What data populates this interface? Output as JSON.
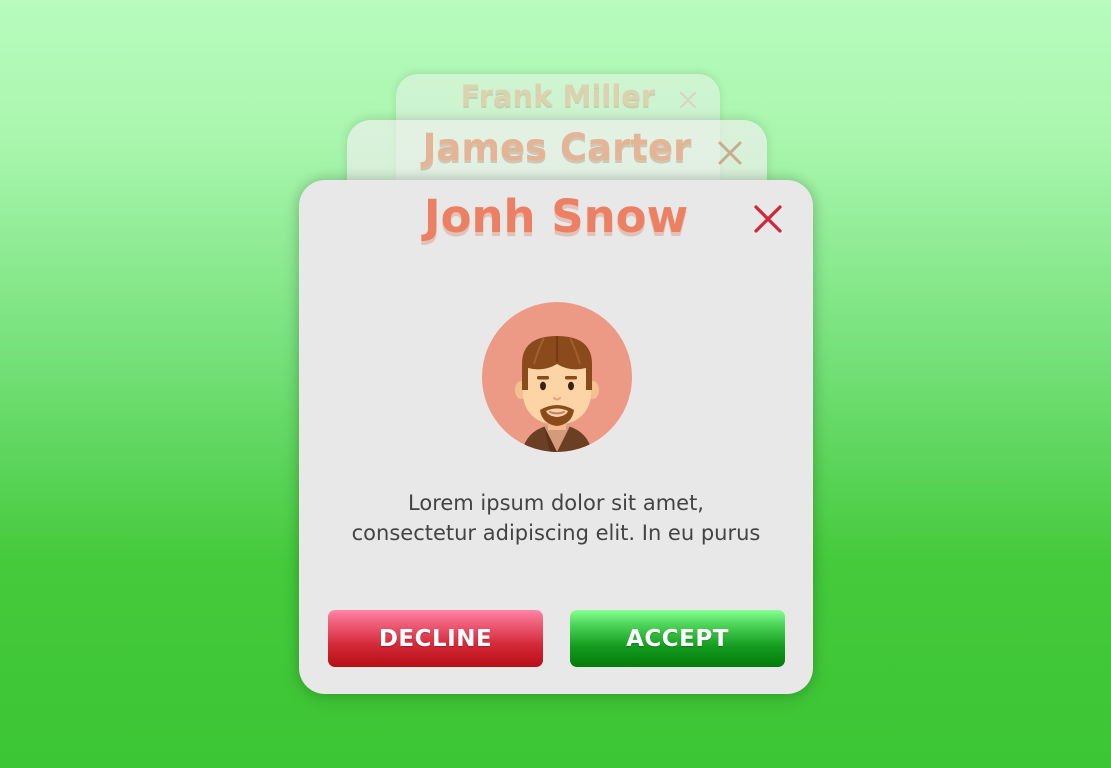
{
  "cards": {
    "back": {
      "name": "Frank Miller"
    },
    "middle": {
      "name": "James Carter"
    },
    "front": {
      "name": "Jonh Snow",
      "message_lines": [
        "Lorem ipsum dolor sit amet,",
        "consectetur adipiscing elit. In eu purus"
      ],
      "decline_label": "DECLINE",
      "accept_label": "ACCEPT"
    }
  },
  "icons": {
    "close": "close-icon",
    "avatar": "man-with-beard-avatar"
  },
  "colors": {
    "name_text": "#ec8063",
    "close_icon": "#d4243c",
    "decline_button": "#c8141e",
    "accept_button": "#0f8f17",
    "avatar_background": "#ec9a86",
    "card_background": "#e8e8e8"
  }
}
